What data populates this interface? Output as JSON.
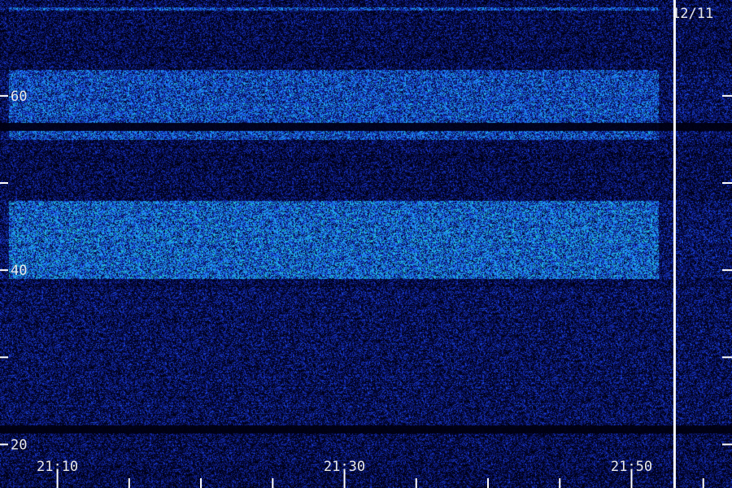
{
  "date_label": "12/11",
  "chart_data": {
    "type": "heatmap",
    "title": "",
    "xlabel": "",
    "ylabel": "",
    "x_tick_labels": [
      "21:10",
      "21:30",
      "21:50"
    ],
    "x_labeled_tick_minutes": [
      70,
      90,
      110
    ],
    "x_minor_tick_step_minutes": 5,
    "xlim_minutes": [
      66,
      117
    ],
    "x_range_display": [
      "21:06",
      "21:57"
    ],
    "y_tick_labels": [
      "60",
      "40",
      "20"
    ],
    "y_major_ticks": [
      60,
      50,
      40,
      30,
      20
    ],
    "ylim": [
      15,
      71
    ],
    "current_time_marker": "21:53",
    "current_time_marker_minutes": 113,
    "colormap": [
      "#000010",
      "#0a1470",
      "#1a3ad6",
      "#1e90ff",
      "#20c8c8",
      "#30e890"
    ],
    "features": [
      {
        "name": "upper band",
        "y_range": [
          55,
          63
        ],
        "intensity": "medium-high"
      },
      {
        "name": "dark stripe",
        "y_center": 56.5,
        "intensity": "none"
      },
      {
        "name": "middle band",
        "y_range": [
          39,
          48
        ],
        "intensity": "high"
      },
      {
        "name": "lower noise floor",
        "y_range": [
          22,
          38
        ],
        "intensity": "low"
      },
      {
        "name": "dark stripe",
        "y_center": 21.8,
        "intensity": "none"
      },
      {
        "name": "faint top line",
        "y_center": 70,
        "intensity": "low"
      }
    ],
    "grid": false,
    "legend": "none"
  }
}
